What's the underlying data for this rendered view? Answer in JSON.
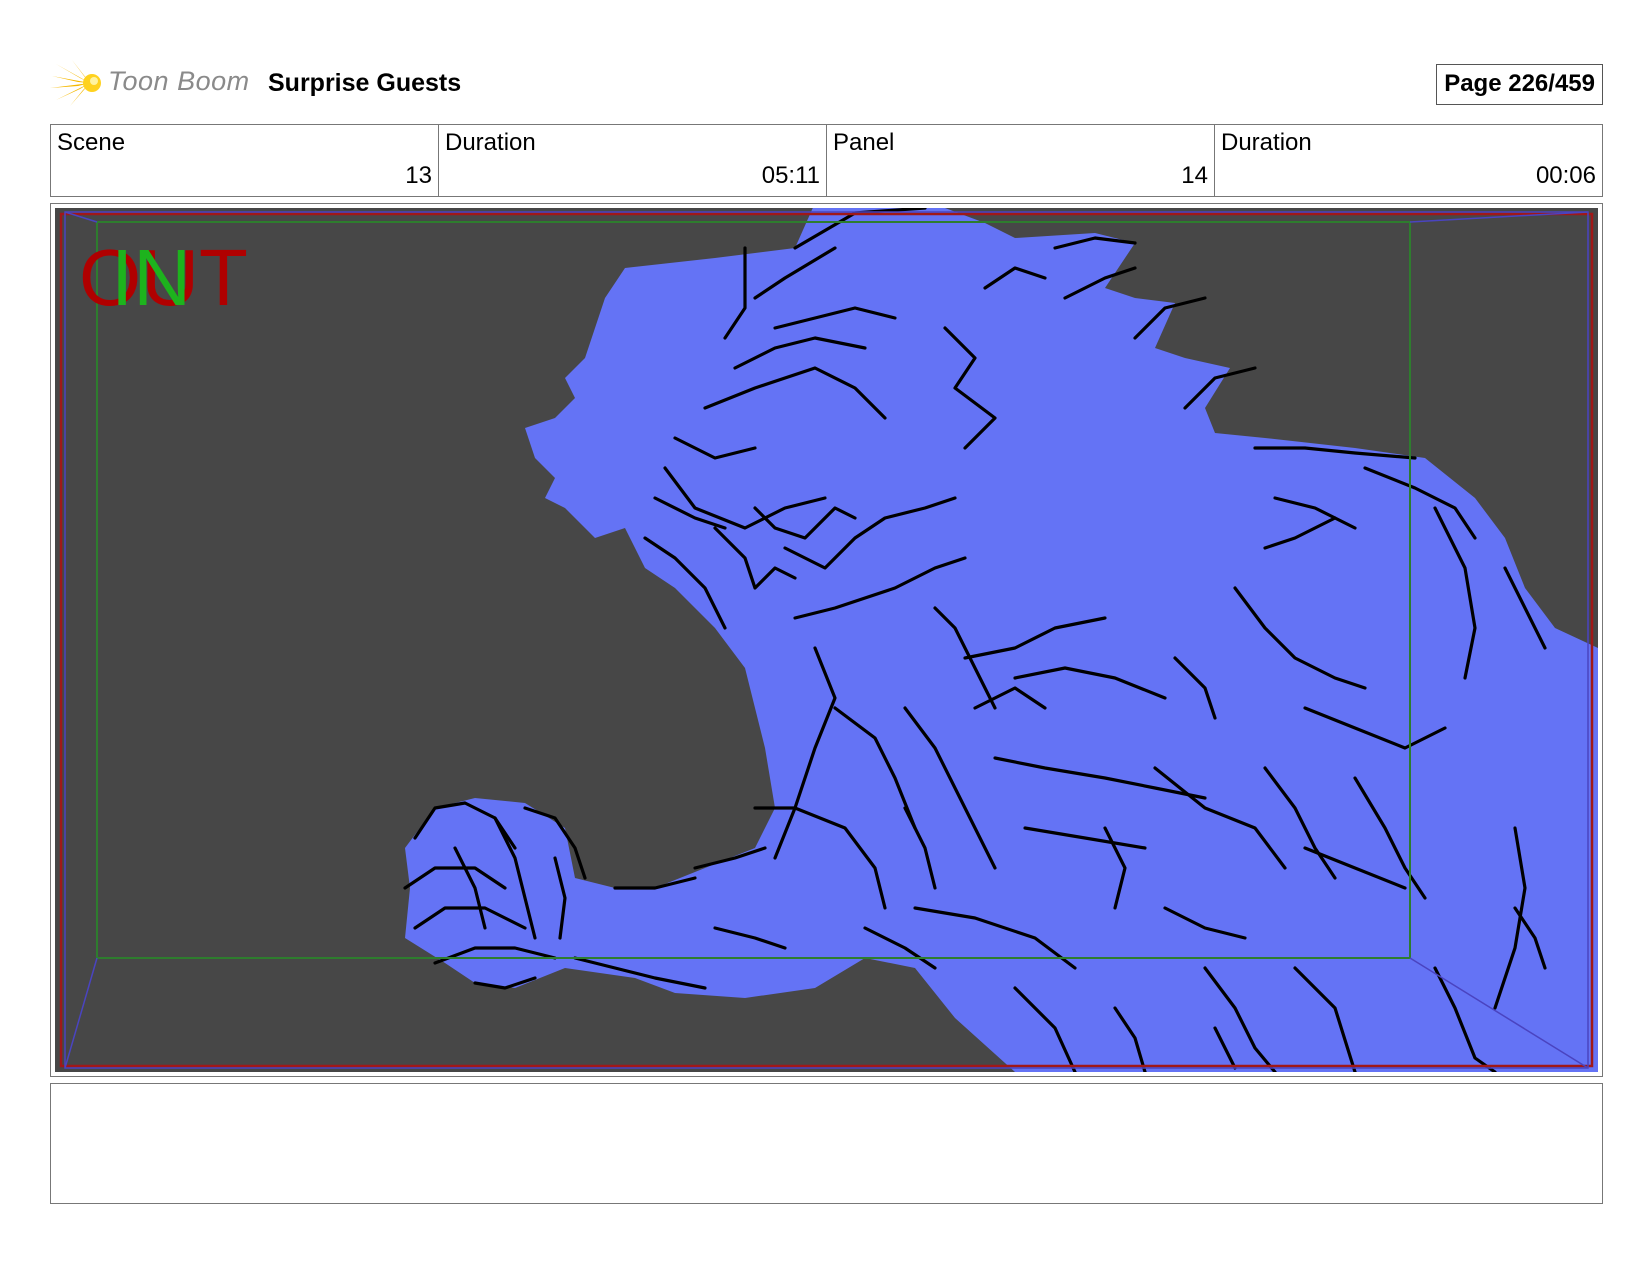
{
  "header": {
    "logo_text": "Toon Boom",
    "project_title": "Surprise Guests",
    "page_label": "Page 226/459"
  },
  "info": [
    {
      "label": "Scene",
      "value": "13"
    },
    {
      "label": "Duration",
      "value": "05:11"
    },
    {
      "label": "Panel",
      "value": "14"
    },
    {
      "label": "Duration",
      "value": "00:06"
    }
  ],
  "panel": {
    "field_out": "OUT",
    "field_in": "IN",
    "colors": {
      "background": "#474747",
      "figure_fill": "#6473f5",
      "line": "#000000",
      "safe_frame": "#2e7d2e",
      "outer_frame": "#a01818",
      "camera_frame": "#4a44c0"
    }
  },
  "notes": {
    "text": ""
  }
}
